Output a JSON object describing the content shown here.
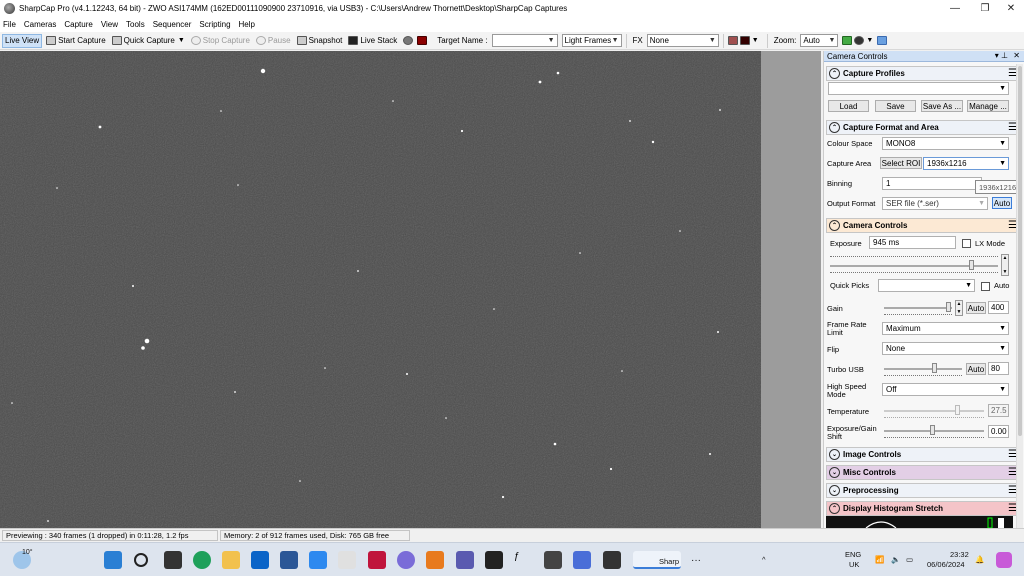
{
  "window": {
    "title": "SharpCap Pro (v4.1.12243, 64 bit) - ZWO ASI174MM (162ED00111090900 23710916, via USB3) - C:\\Users\\Andrew Thornett\\Desktop\\SharpCap Captures",
    "minimize": "—",
    "maximize": "❐",
    "close": "✕"
  },
  "menu": [
    "File",
    "Cameras",
    "Capture",
    "View",
    "Tools",
    "Sequencer",
    "Scripting",
    "Help"
  ],
  "toolbar": {
    "live_view": "Live View",
    "start_capture": "Start Capture",
    "quick_capture": "Quick Capture",
    "stop_capture": "Stop Capture",
    "pause": "Pause",
    "snapshot": "Snapshot",
    "live_stack": "Live Stack",
    "target_name_label": "Target Name :",
    "target_name_value": "",
    "frame_type": "Light Frames",
    "fx_label": "FX",
    "fx_value": "None",
    "zoom_label": "Zoom:",
    "zoom_value": "Auto"
  },
  "panel": {
    "header": "Camera Controls",
    "pin": "▾ ⊥",
    "close": "✕",
    "capture_profiles": {
      "title": "Capture Profiles",
      "profile_value": "",
      "load": "Load",
      "save": "Save",
      "save_as": "Save As ...",
      "manage": "Manage ..."
    },
    "capture_format": {
      "title": "Capture Format and Area",
      "colour_space_label": "Colour Space",
      "colour_space_value": "MONO8",
      "capture_area_label": "Capture Area",
      "select_roi": "Select ROI",
      "capture_area_value": "1936x1216",
      "binning_label": "Binning",
      "binning_value": "1",
      "tooltip": "1936x1216",
      "output_format_label": "Output Format",
      "output_format_value": "SER file (*.ser)",
      "auto": "Auto"
    },
    "camera_controls": {
      "title": "Camera Controls",
      "exposure_label": "Exposure",
      "exposure_value": "945 ms",
      "lx_mode": "LX Mode",
      "quick_picks_label": "Quick Picks",
      "quick_picks_auto": "Auto",
      "gain_label": "Gain",
      "gain_auto": "Auto",
      "gain_value": "400",
      "frame_rate_label": "Frame Rate Limit",
      "frame_rate_value": "Maximum",
      "flip_label": "Flip",
      "flip_value": "None",
      "turbo_usb_label": "Turbo USB",
      "turbo_usb_auto": "Auto",
      "turbo_usb_value": "80",
      "high_speed_label": "High Speed Mode",
      "high_speed_value": "Off",
      "temperature_label": "Temperature",
      "temperature_value": "27.5",
      "exp_gain_shift_label": "Exposure/Gain Shift",
      "exp_gain_shift_value": "0.00"
    },
    "sections": [
      {
        "title": "Image Controls",
        "color": "#eef2f8"
      },
      {
        "title": "Misc Controls",
        "color": "#e3cfe6"
      },
      {
        "title": "Preprocessing",
        "color": "#eef2f8"
      },
      {
        "title": "Display Histogram Stretch",
        "color": "#f4c4c8"
      }
    ]
  },
  "status": {
    "previewing": "Previewing : 340 frames (1 dropped) in 0:11:28, 1.2 fps",
    "memory": "Memory: 2 of 912 frames used, Disk: 765 GB free"
  },
  "taskbar": {
    "weather": "10°",
    "active_app": "Sharp",
    "more": "···",
    "lang_top": "ENG",
    "lang_bottom": "UK",
    "time": "23:32",
    "date": "06/06/2024",
    "chevron": "^"
  }
}
